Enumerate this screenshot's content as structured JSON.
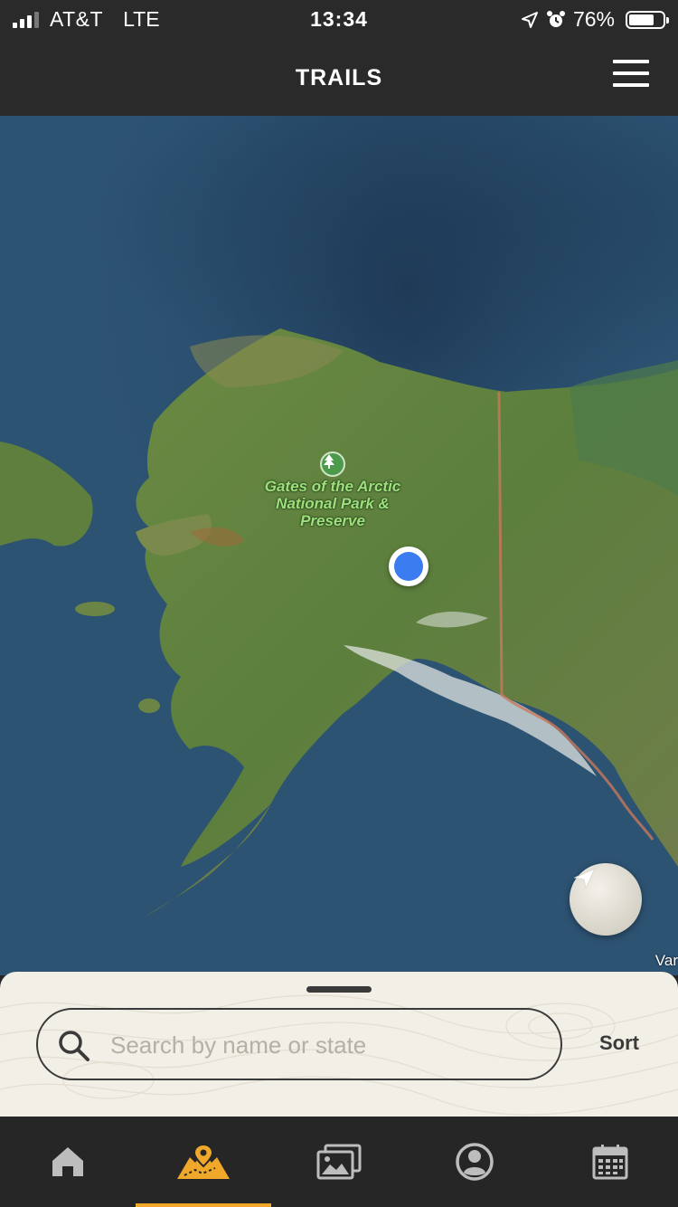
{
  "status_bar": {
    "carrier": "AT&T",
    "network": "LTE",
    "time": "13:34",
    "battery_percent": "76%",
    "battery_level": 0.76,
    "icons": [
      "signal-icon",
      "location-arrow-icon",
      "alarm-icon",
      "battery-icon"
    ]
  },
  "header": {
    "title": "TRAILS",
    "menu_icon": "hamburger-menu-icon"
  },
  "map": {
    "park_label": "Gates of the Arctic National Park & Preserve",
    "park_icon": "tree-icon",
    "edge_label": "Var",
    "locate_icon": "location-arrow-icon",
    "user_location_color": "#3b7cf0"
  },
  "search": {
    "placeholder": "Search by name or state",
    "value": "",
    "sort_label": "Sort"
  },
  "tabs": [
    {
      "name": "home",
      "icon": "home-icon",
      "active": false
    },
    {
      "name": "trails-map",
      "icon": "map-pin-icon",
      "active": true
    },
    {
      "name": "photos",
      "icon": "photos-icon",
      "active": false
    },
    {
      "name": "profile",
      "icon": "profile-icon",
      "active": false
    },
    {
      "name": "calendar",
      "icon": "calendar-icon",
      "active": false
    }
  ],
  "colors": {
    "accent": "#f0a82b",
    "bar_background": "#2a2a2a",
    "sheet_background": "#f2efe6"
  }
}
